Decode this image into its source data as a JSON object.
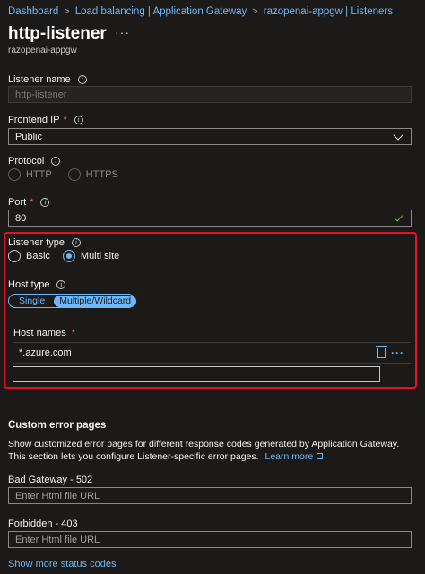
{
  "breadcrumb": [
    "Dashboard",
    "Load balancing | Application Gateway",
    "razopenai-appgw | Listeners"
  ],
  "breadcrumb_sep": ">",
  "header": {
    "title": "http-listener",
    "more": "···",
    "subtitle": "razopenai-appgw"
  },
  "listener_name": {
    "label": "Listener name",
    "value": "http-listener"
  },
  "frontend_ip": {
    "label": "Frontend IP",
    "required": "*",
    "value": "Public"
  },
  "protocol": {
    "label": "Protocol",
    "options": [
      "HTTP",
      "HTTPS"
    ]
  },
  "port": {
    "label": "Port",
    "required": "*",
    "value": "80"
  },
  "listener_type": {
    "label": "Listener type",
    "options": [
      "Basic",
      "Multi site"
    ],
    "selected": "Multi site"
  },
  "host_type": {
    "label": "Host type",
    "options": [
      "Single",
      "Multiple/Wildcard"
    ],
    "selected": "Multiple/Wildcard"
  },
  "host_names": {
    "label": "Host names",
    "required": "*",
    "entries": [
      "*.azure.com"
    ],
    "new_value": ""
  },
  "custom_error_pages": {
    "title": "Custom error pages",
    "description": "Show customized error pages for different response codes generated by Application Gateway. This section lets you configure Listener-specific error pages.",
    "learn_more": "Learn more",
    "bad_gateway": {
      "label": "Bad Gateway - 502",
      "placeholder": "Enter Html file URL"
    },
    "forbidden": {
      "label": "Forbidden - 403",
      "placeholder": "Enter Html file URL"
    },
    "show_more": "Show more status codes"
  },
  "icons": {
    "info": "info-icon",
    "chevron": "chevron-down-icon",
    "check": "checkmark-icon",
    "delete": "trash-icon",
    "ellipsis": "more-icon",
    "external": "external-link-icon"
  },
  "colors": {
    "background": "#1b1a19",
    "accent": "#6cb8f6",
    "highlight": "#e81123",
    "required": "#f1707b",
    "valid": "#6bb700"
  }
}
